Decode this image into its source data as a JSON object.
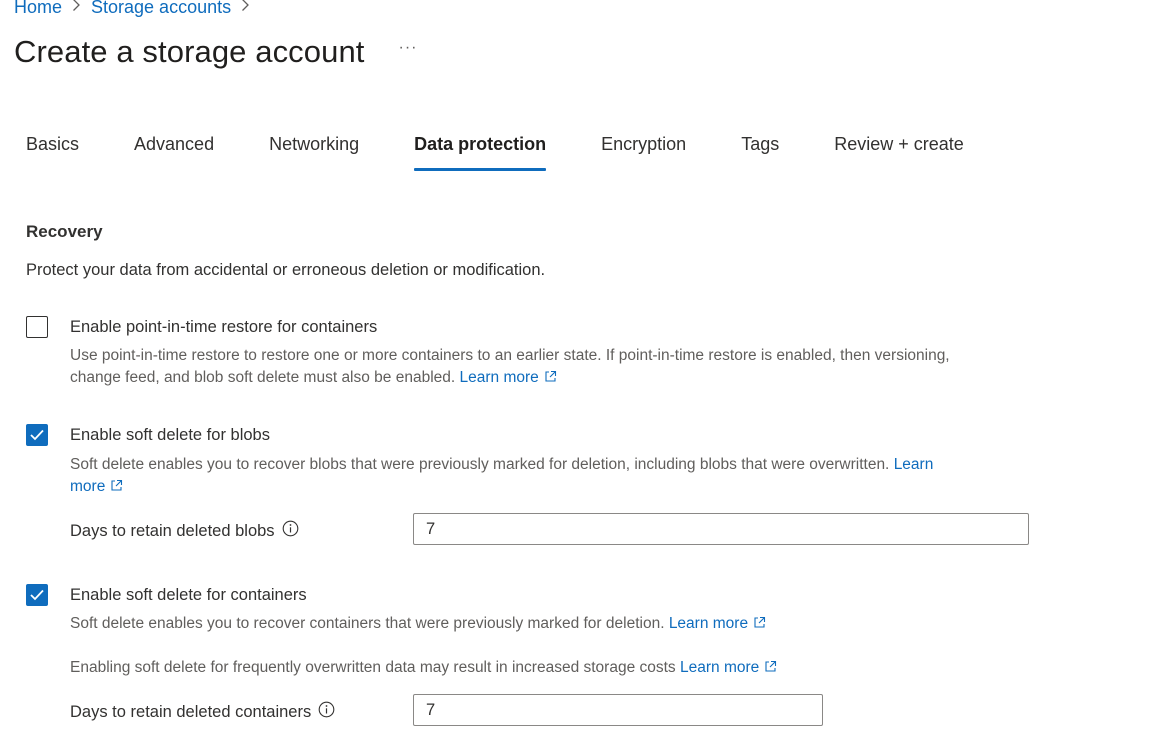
{
  "breadcrumb": {
    "home": "Home",
    "storage_accounts": "Storage accounts"
  },
  "header": {
    "title": "Create a storage account",
    "more": "···"
  },
  "tabs": [
    {
      "label": "Basics"
    },
    {
      "label": "Advanced"
    },
    {
      "label": "Networking"
    },
    {
      "label": "Data protection",
      "active": true
    },
    {
      "label": "Encryption"
    },
    {
      "label": "Tags"
    },
    {
      "label": "Review + create"
    }
  ],
  "recovery": {
    "title": "Recovery",
    "description": "Protect your data from accidental or erroneous deletion or modification.",
    "pitr": {
      "checked": false,
      "label": "Enable point-in-time restore for containers",
      "help_line1": "Use point-in-time restore to restore one or more containers to an earlier state. If point-in-time restore is enabled, then versioning,",
      "help_line2": "change feed, and blob soft delete must also be enabled.",
      "learn_more": "Learn more"
    },
    "blob_soft_delete": {
      "checked": true,
      "label": "Enable soft delete for blobs",
      "help_line1": "Soft delete enables you to recover blobs that were previously marked for deletion, including blobs that were overwritten.",
      "learn_more_1": "Learn",
      "learn_more_2": "more",
      "days_label": "Days to retain deleted blobs",
      "days_value": "7"
    },
    "container_soft_delete": {
      "checked": true,
      "label": "Enable soft delete for containers",
      "help": "Soft delete enables you to recover containers that were previously marked for deletion.",
      "learn_more": "Learn more",
      "cost_note": "Enabling soft delete for frequently overwritten data may result in increased storage costs",
      "cost_learn_more": "Learn more",
      "days_label": "Days to retain deleted containers",
      "days_value": "7"
    }
  },
  "colors": {
    "accent": "#0f6cbd",
    "text": "#323130",
    "muted": "#605e5c"
  },
  "icons": {
    "checkbox_checked": "checkmark-icon",
    "info": "info-icon",
    "external": "external-link-icon",
    "breadcrumb_separator": "chevron-right-icon"
  }
}
